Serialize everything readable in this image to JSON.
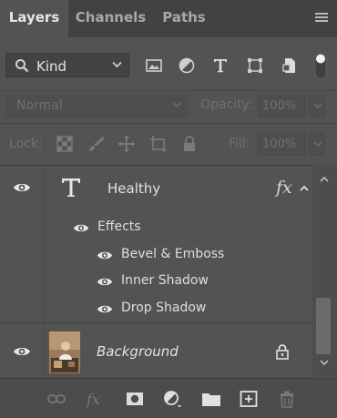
{
  "tabs": {
    "layers": "Layers",
    "channels": "Channels",
    "paths": "Paths"
  },
  "filter": {
    "kind_label": "Kind",
    "icons": [
      "search-icon",
      "image-filter-icon",
      "adjustment-filter-icon",
      "type-filter-icon",
      "shape-filter-icon",
      "smart-object-filter-icon",
      "filter-toggle-icon"
    ]
  },
  "blend": {
    "mode": "Normal",
    "opacity_label": "Opacity:",
    "opacity_value": "100%"
  },
  "lock": {
    "label": "Lock:",
    "icons": [
      "lock-transparent-pixels-icon",
      "lock-image-pixels-icon",
      "lock-position-icon",
      "lock-artboard-icon",
      "lock-all-icon"
    ],
    "fill_label": "Fill:",
    "fill_value": "100%"
  },
  "layers": [
    {
      "name": "Healthy",
      "type": "text",
      "fx_label": "fx",
      "effects_label": "Effects",
      "effects": [
        "Bevel & Emboss",
        "Inner Shadow",
        "Drop Shadow"
      ]
    },
    {
      "name": "Background",
      "type": "image",
      "locked": true
    }
  ],
  "bottom_icons": [
    "link-layers-icon",
    "layer-style-fx-icon",
    "add-mask-icon",
    "adjustment-layer-icon",
    "new-group-icon",
    "new-layer-icon",
    "delete-layer-icon"
  ],
  "colors": {
    "panel_bg": "#535353",
    "tab_bar_bg": "#424242",
    "text": "#e3e3e3",
    "disabled_text": "#707070"
  }
}
